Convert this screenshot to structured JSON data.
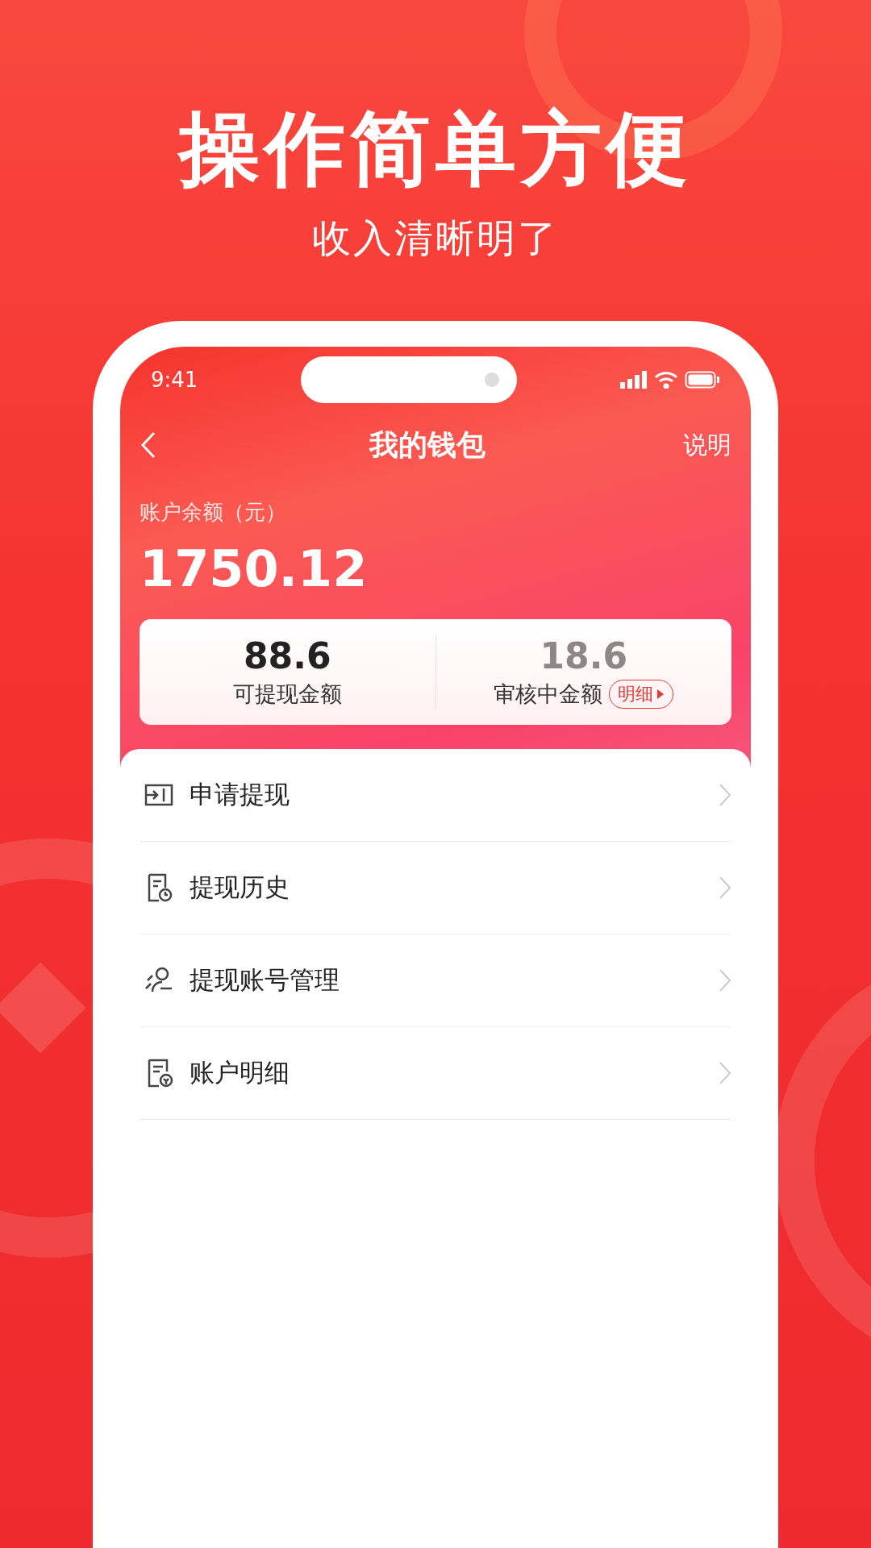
{
  "headline": "操作简单方便",
  "subheadline": "收入清晰明了",
  "status_bar": {
    "time": "9:41"
  },
  "nav": {
    "title": "我的钱包",
    "action": "说明"
  },
  "balance": {
    "label": "账户余额（元）",
    "amount": "1750.12"
  },
  "summary": [
    {
      "value": "88.6",
      "label": "可提现金额",
      "muted": false
    },
    {
      "value": "18.6",
      "label": "审核中金额",
      "muted": true,
      "link": "明细"
    }
  ],
  "menu": [
    {
      "kind": "withdraw",
      "label": "申请提现"
    },
    {
      "kind": "history",
      "label": "提现历史"
    },
    {
      "kind": "account",
      "label": "提现账号管理"
    },
    {
      "kind": "detail",
      "label": "账户明细"
    }
  ]
}
